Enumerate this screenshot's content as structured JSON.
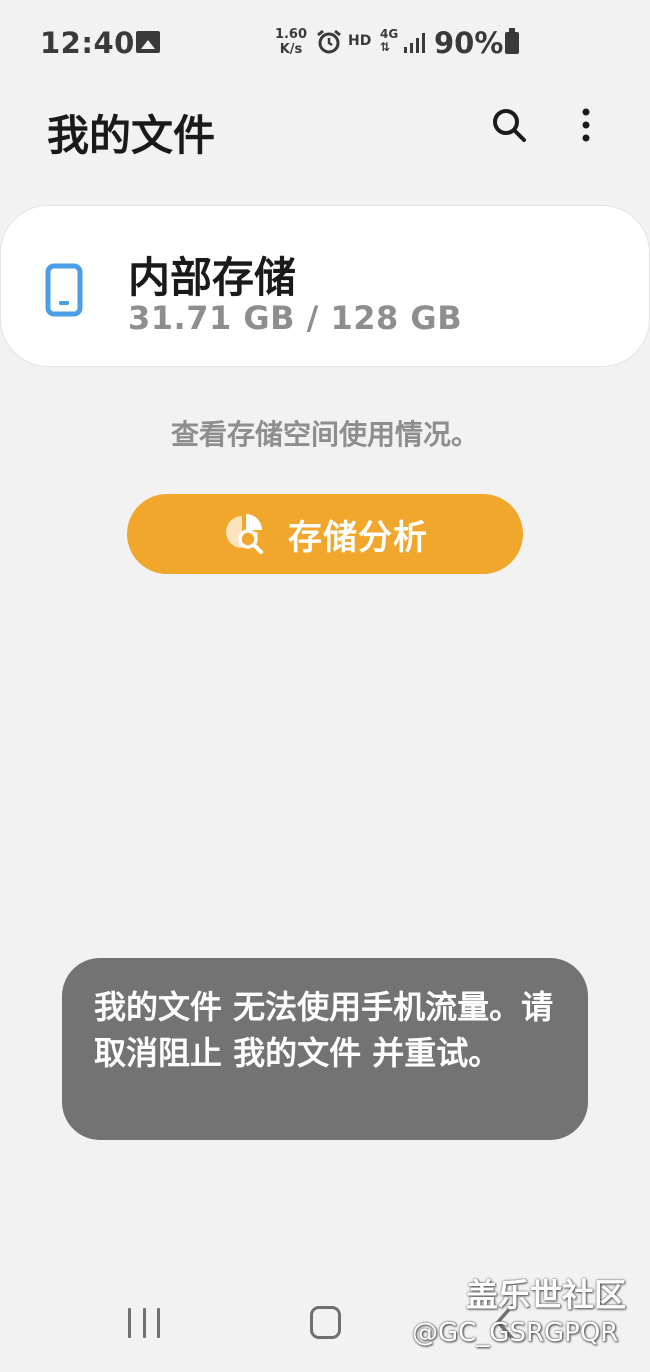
{
  "status_bar": {
    "time": "12:40",
    "speed_value": "1.60",
    "speed_unit": "K/s",
    "hd": "HD",
    "network": "4G",
    "battery": "90%"
  },
  "app_bar": {
    "title": "我的文件"
  },
  "storage": {
    "name": "内部存储",
    "usage": "31.71 GB / 128 GB",
    "hint": "查看存储空间使用情况。",
    "analyze_label": "存储分析"
  },
  "toast": {
    "message": "我的文件 无法使用手机流量。请取消阻止 我的文件 并重试。"
  },
  "watermark": {
    "line1": "盖乐世社区",
    "line2": "@GC_GSRGPQR"
  },
  "colors": {
    "accent": "#f0a72b",
    "phone_icon": "#4a9fe6",
    "toast_bg": "#737373"
  }
}
